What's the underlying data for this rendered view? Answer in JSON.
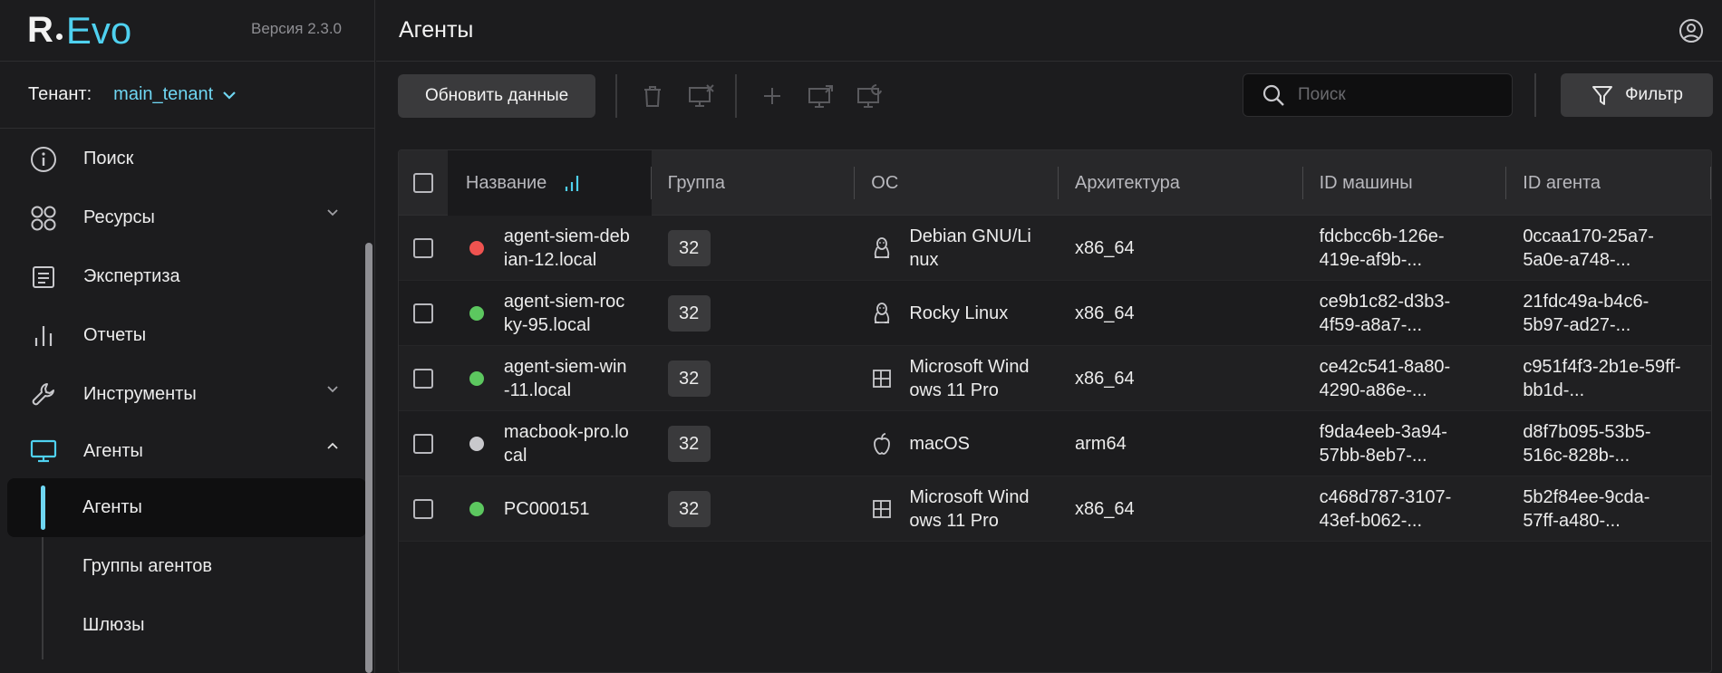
{
  "brand": {
    "logo_r": "R",
    "logo_evo": "Evo",
    "version": "Версия 2.3.0"
  },
  "tenant": {
    "label": "Тенант:",
    "value": "main_tenant"
  },
  "nav": {
    "search": "Поиск",
    "resources": "Ресурсы",
    "expertise": "Экспертиза",
    "reports": "Отчеты",
    "tools": "Инструменты",
    "agents": "Агенты",
    "sub": {
      "agents": "Агенты",
      "agent_groups": "Группы агентов",
      "gateways": "Шлюзы"
    }
  },
  "header": {
    "title": "Агенты"
  },
  "toolbar": {
    "refresh_label": "Обновить данные",
    "search_placeholder": "Поиск",
    "filter_label": "Фильтр"
  },
  "table": {
    "columns": [
      "Название",
      "Группа",
      "ОС",
      "Архитектура",
      "ID машины",
      "ID агента"
    ],
    "rows": [
      {
        "status": "#ef5350",
        "name": "agent-siem-deb ian-12.local",
        "name1": "agent-siem-deb",
        "name2": "ian-12.local",
        "group": "32",
        "os_icon": "linux-icon",
        "os1": "Debian GNU/Li",
        "os2": "nux",
        "arch": "x86_64",
        "mid1": "fdcbcc6b-126e-",
        "mid2": "419e-af9b-...",
        "aid1": "0ccaa170-25a7-",
        "aid2": "5a0e-a748-..."
      },
      {
        "status": "#5cc75f",
        "name1": "agent-siem-roc",
        "name2": "ky-95.local",
        "group": "32",
        "os_icon": "linux-icon",
        "os1": "Rocky Linux",
        "os2": "",
        "arch": "x86_64",
        "mid1": "ce9b1c82-d3b3-",
        "mid2": "4f59-a8a7-...",
        "aid1": "21fdc49a-b4c6-",
        "aid2": "5b97-ad27-..."
      },
      {
        "status": "#5cc75f",
        "name1": "agent-siem-win",
        "name2": "-11.local",
        "group": "32",
        "os_icon": "windows-icon",
        "os1": "Microsoft Wind",
        "os2": "ows 11 Pro",
        "arch": "x86_64",
        "mid1": "ce42c541-8a80-",
        "mid2": "4290-a86e-...",
        "aid1": "c951f4f3-2b1e-59ff-",
        "aid2": "bb1d-..."
      },
      {
        "status": "#c8c8cc",
        "name1": "macbook-pro.lo",
        "name2": "cal",
        "group": "32",
        "os_icon": "apple-icon",
        "os1": "macOS",
        "os2": "",
        "arch": "arm64",
        "mid1": "f9da4eeb-3a94-",
        "mid2": "57bb-8eb7-...",
        "aid1": "d8f7b095-53b5-",
        "aid2": "516c-828b-..."
      },
      {
        "status": "#5cc75f",
        "name1": "PC000151",
        "name2": "",
        "group": "32",
        "os_icon": "windows-icon",
        "os1": "Microsoft Wind",
        "os2": "ows 11 Pro",
        "arch": "x86_64",
        "mid1": "c468d787-3107-",
        "mid2": "43ef-b062-...",
        "aid1": "5b2f84ee-9cda-",
        "aid2": "57ff-a480-..."
      }
    ]
  },
  "colors": {
    "accent": "#4fd1f0",
    "background": "#1c1c1e",
    "button": "#3a3a3c"
  }
}
